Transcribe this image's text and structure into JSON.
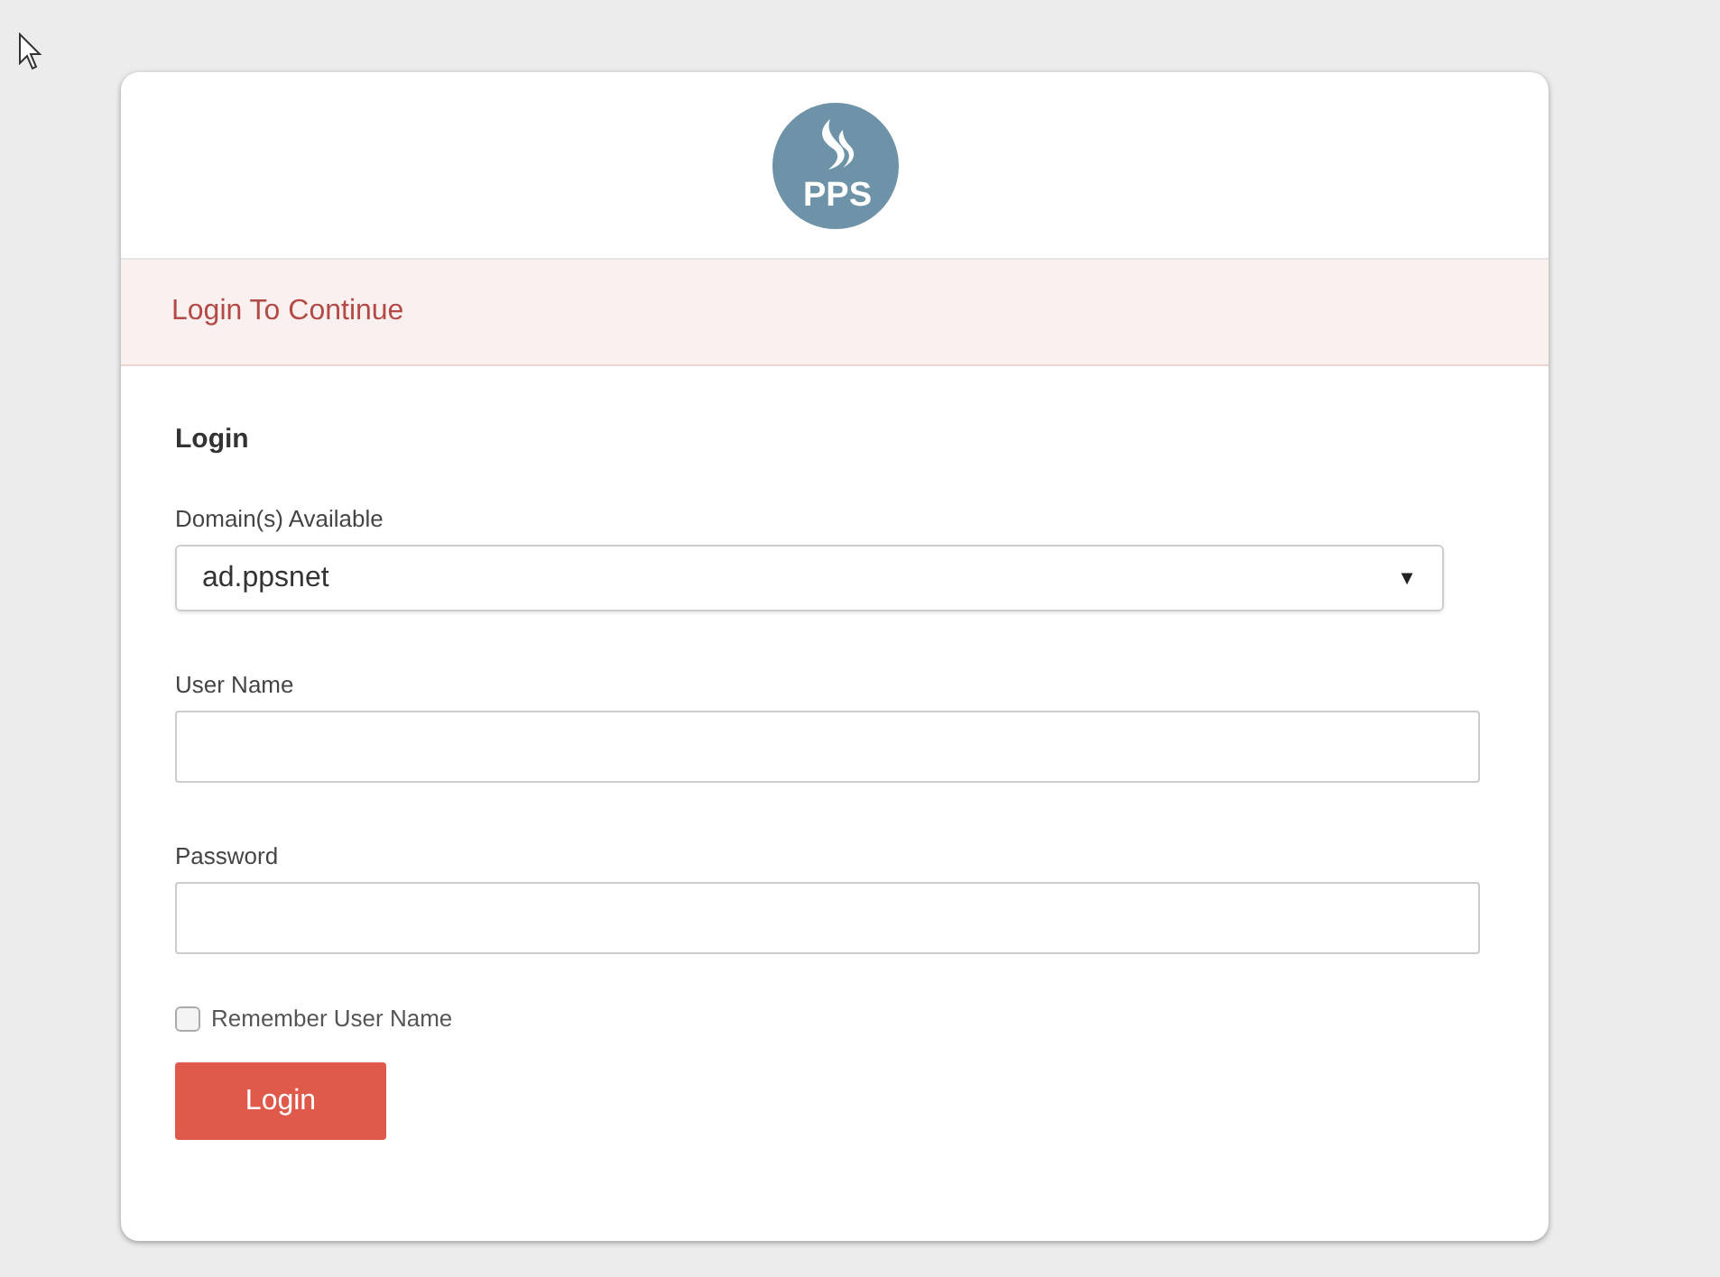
{
  "logo": {
    "text": "PPS"
  },
  "alert": {
    "text": "Login To Continue"
  },
  "form": {
    "title": "Login",
    "fields": [
      {
        "kind": "select",
        "label": "Domain(s) Available",
        "value": "ad.ppsnet",
        "caret": "▼"
      },
      {
        "kind": "text",
        "label": "User Name"
      },
      {
        "kind": "password",
        "label": "Password"
      }
    ],
    "remember": {
      "label": "Remember User Name",
      "checked": false
    },
    "submit": "Login"
  }
}
